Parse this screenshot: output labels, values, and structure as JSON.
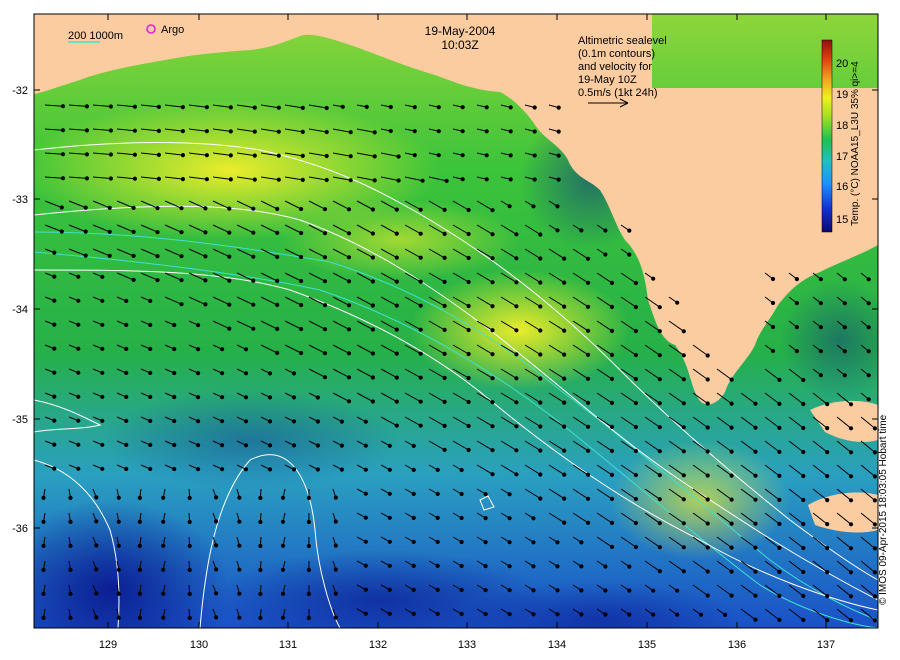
{
  "title": {
    "date": "19-May-2004",
    "time": "10:03Z"
  },
  "scale_legend": {
    "text": "200  1000m"
  },
  "argo_legend": {
    "label": "Argo"
  },
  "altimetry_note": {
    "lines": [
      "Altimetric sealevel",
      "(0.1m contours)",
      "and velocity for",
      "19-May 10Z",
      "0.5m/s (1kt 24h)"
    ]
  },
  "colorbar": {
    "label": "Temp. (°C) NOAA15_L3U 35% qi>=4",
    "ticks": [
      "15",
      "16",
      "17",
      "18",
      "19",
      "20"
    ],
    "colors": [
      "#0a0a70",
      "#1030d0",
      "#1e90ff",
      "#20c0c0",
      "#20c050",
      "#a0e020",
      "#f0f020",
      "#f0a020",
      "#e04010",
      "#901010"
    ]
  },
  "axes": {
    "x_ticks": [
      "129",
      "130",
      "131",
      "132",
      "133",
      "134",
      "135",
      "136",
      "137"
    ],
    "y_ticks": [
      "-32",
      "-33",
      "-34",
      "-35",
      "-36"
    ]
  },
  "credit": {
    "text": "© IMOS 09-Apr-2015 18:03:05 Hobart time"
  },
  "colors": {
    "land": "#fbcca0",
    "sea_cold": "#1640c8",
    "sea_mid": "#22b040",
    "sea_warm": "#e8ea22",
    "contour": "#ffffff",
    "isobath": "#40e0d0"
  }
}
